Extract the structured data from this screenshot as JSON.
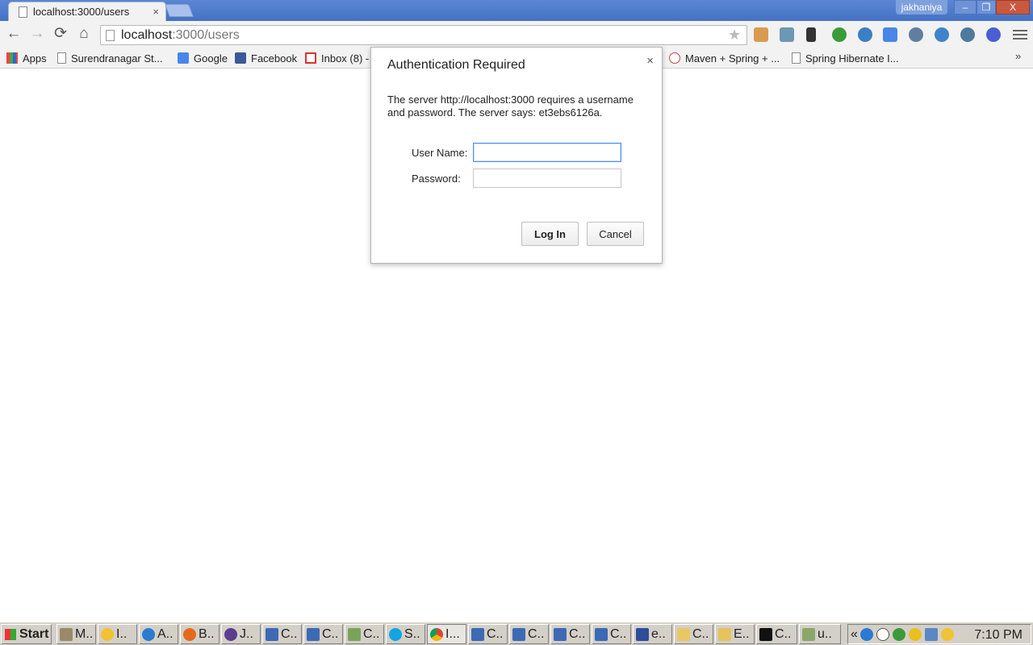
{
  "browser": {
    "tab_title": "localhost:3000/users",
    "tab_close": "×",
    "profile_name": "jakhaniya",
    "window_buttons": [
      "–",
      "❐",
      "X"
    ],
    "url_host": "localhost",
    "url_path": ":3000/users",
    "nav": {
      "back": "←",
      "forward": "→",
      "reload": "⟳",
      "home": "⌂"
    }
  },
  "bookmarks": {
    "items": [
      {
        "label": "Apps",
        "icon": "apps-grid-icon"
      },
      {
        "label": "Surendranagar St...",
        "icon": "page-icon"
      },
      {
        "label": "Google",
        "icon": "google-icon"
      },
      {
        "label": "Facebook",
        "icon": "facebook-icon"
      },
      {
        "label": "Inbox (8) -",
        "icon": "gmail-icon"
      },
      {
        "label": "Maven + Spring + ...",
        "icon": "question-page-icon"
      },
      {
        "label": "Spring Hibernate I...",
        "icon": "page-icon"
      }
    ],
    "overflow": "»"
  },
  "dialog": {
    "title": "Authentication Required",
    "close": "×",
    "message": "The server http://localhost:3000 requires a username and password. The server says: et3ebs6126a.",
    "username_label": "User Name:",
    "username_value": "",
    "password_label": "Password:",
    "password_value": "",
    "login_label": "Log In",
    "cancel_label": "Cancel"
  },
  "taskbar": {
    "start_label": "Start",
    "tasks": [
      "M..",
      "I..",
      "A..",
      "B..",
      "J..",
      "C..",
      "C..",
      "C..",
      "S..",
      "I...",
      "C..",
      "C..",
      "C..",
      "C..",
      "e..",
      "C..",
      "E..",
      "C..",
      "u.."
    ],
    "tray_chevron": "«",
    "clock": "7:10 PM"
  },
  "colors": {
    "accent": "#4d90fe",
    "titlebar": "#4472c4",
    "taskbar": "#d4d0c8"
  }
}
